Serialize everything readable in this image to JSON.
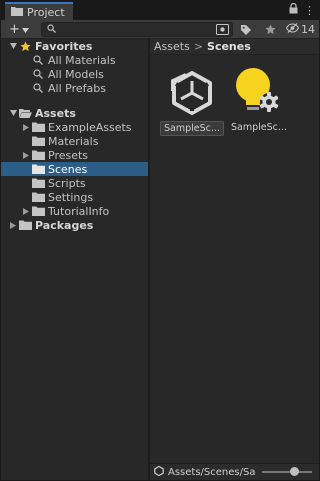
{
  "tab": {
    "title": "Project",
    "icon": "folder-icon"
  },
  "tab_actions": {
    "lock": "lock-icon",
    "menu": "⋮"
  },
  "toolbar": {
    "add_label": "+",
    "search": {
      "value": "",
      "placeholder": ""
    },
    "hidden_count": "14"
  },
  "tree": {
    "favorites": {
      "label": "Favorites",
      "items": [
        "All Materials",
        "All Models",
        "All Prefabs"
      ]
    },
    "assets": {
      "label": "Assets",
      "items": [
        {
          "label": "ExampleAssets",
          "expandable": true
        },
        {
          "label": "Materials",
          "expandable": false
        },
        {
          "label": "Presets",
          "expandable": true
        },
        {
          "label": "Scenes",
          "expandable": false,
          "selected": true
        },
        {
          "label": "Scripts",
          "expandable": false
        },
        {
          "label": "Settings",
          "expandable": false
        },
        {
          "label": "TutorialInfo",
          "expandable": true
        }
      ]
    },
    "packages": {
      "label": "Packages"
    }
  },
  "breadcrumb": {
    "root": "Assets",
    "separator": ">",
    "current": "Scenes"
  },
  "assets_grid": [
    {
      "name": "SampleSc...",
      "icon": "unity-scene-icon",
      "selected": true
    },
    {
      "name": "SampleSc...",
      "icon": "lighting-settings-icon",
      "selected": false
    }
  ],
  "status": {
    "path": "Assets/Scenes/Sa",
    "zoom_level": 0.6
  },
  "colors": {
    "selection": "#2c5d87",
    "accent": "#3a79bb",
    "bulb": "#f5d31e"
  }
}
